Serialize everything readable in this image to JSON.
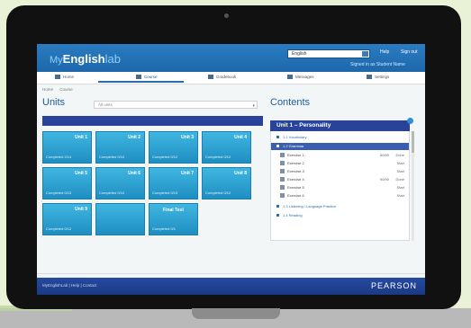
{
  "app": {
    "brand_prefix": "My",
    "brand_main": "English",
    "brand_suffix": "lab"
  },
  "header": {
    "course_value": "English",
    "help_label": "Help",
    "signout_label": "Sign out",
    "user_line": "Signed in as Student Name"
  },
  "nav": {
    "items": [
      {
        "label": "Home"
      },
      {
        "label": "Course"
      },
      {
        "label": "Gradebook"
      },
      {
        "label": "Messages"
      },
      {
        "label": "Settings"
      }
    ],
    "active_index": 1
  },
  "breadcrumb": [
    "Home",
    "Course"
  ],
  "units": {
    "heading": "Units",
    "filter_value": "All units",
    "tiles": [
      {
        "title": "Unit 1",
        "foot": "Completed 2/14"
      },
      {
        "title": "Unit 2",
        "foot": "Completed 0/12"
      },
      {
        "title": "Unit 3",
        "foot": "Completed 0/12"
      },
      {
        "title": "Unit 4",
        "foot": "Completed 0/12"
      },
      {
        "title": "Unit 5",
        "foot": "Completed 0/13"
      },
      {
        "title": "Unit 6",
        "foot": "Completed 0/12"
      },
      {
        "title": "Unit 7",
        "foot": "Completed 0/13"
      },
      {
        "title": "Unit 8",
        "foot": "Completed 0/12"
      },
      {
        "title": "Unit 9",
        "foot": "Completed 0/12"
      },
      {
        "title": "",
        "foot": ""
      },
      {
        "title": "Final Test",
        "foot": "Completed 0/1"
      }
    ]
  },
  "contents": {
    "heading": "Contents",
    "unit_title": "Unit 1 – Personality",
    "rows": [
      {
        "type": "section",
        "label": "1.1 Vocabulary",
        "selected": false
      },
      {
        "type": "section",
        "label": "1.2 Grammar",
        "selected": true
      },
      {
        "type": "item",
        "label": "Exercise 1",
        "score": "80/80",
        "status": "Done"
      },
      {
        "type": "item",
        "label": "Exercise 2",
        "score": "",
        "status": "Start"
      },
      {
        "type": "item",
        "label": "Exercise 3",
        "score": "",
        "status": "Start"
      },
      {
        "type": "item",
        "label": "Exercise 4",
        "score": "90/90",
        "status": "Done"
      },
      {
        "type": "item",
        "label": "Exercise 5",
        "score": "",
        "status": "Start"
      },
      {
        "type": "item",
        "label": "Exercise 6",
        "score": "",
        "status": "Start"
      },
      {
        "type": "section",
        "label": "1.3 Listening / Language Practice",
        "selected": false
      },
      {
        "type": "section",
        "label": "1.4 Reading",
        "selected": false
      }
    ]
  },
  "footer": {
    "left_text": "MyEnglishLab | Help | Contact",
    "brand": "PEARSON"
  },
  "colors": {
    "topbar": "#1e67ab",
    "tile": "#2aa3d3",
    "footer": "#1b3a86",
    "accent": "#29429a"
  }
}
